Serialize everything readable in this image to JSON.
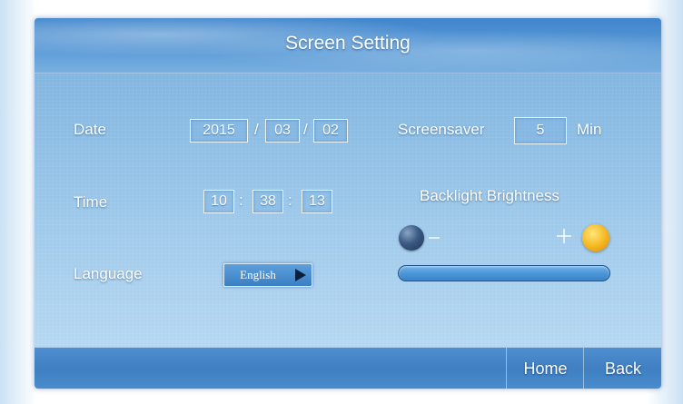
{
  "title": "Screen Setting",
  "date": {
    "label": "Date",
    "year": "2015",
    "month": "03",
    "day": "02",
    "separator": "/"
  },
  "time": {
    "label": "Time",
    "hour": "10",
    "minute": "38",
    "second": "13",
    "separator": ":"
  },
  "language": {
    "label": "Language",
    "value": "English"
  },
  "screensaver": {
    "label": "Screensaver",
    "value": "5",
    "unit": "Min"
  },
  "backlight": {
    "label": "Backlight Brightness",
    "level": 1.0,
    "minus": "−",
    "plus": "+"
  },
  "nav": {
    "home": "Home",
    "back": "Back"
  },
  "colors": {
    "accent": "#3f85cc",
    "text": "#ffffff",
    "highlight": "#f5b51e"
  },
  "icons": {
    "brightness_low": "brightness-low-icon",
    "brightness_high": "brightness-high-icon",
    "language_next": "play-arrow-icon"
  }
}
